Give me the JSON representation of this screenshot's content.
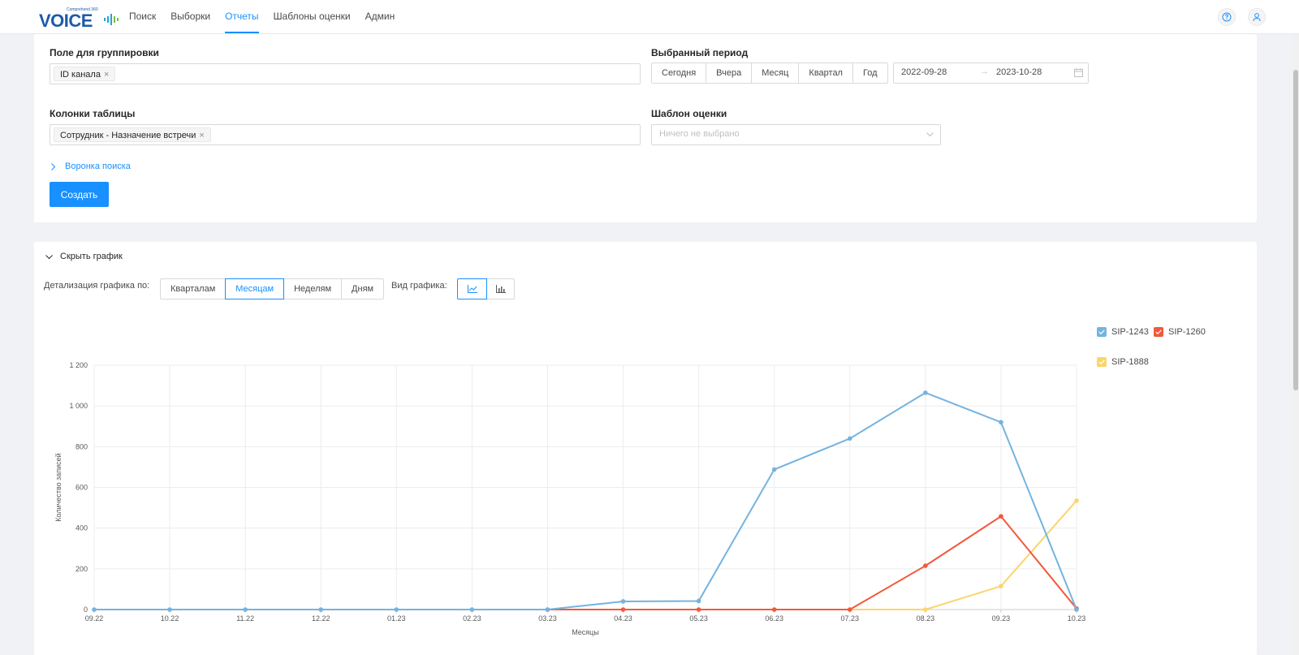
{
  "logo": {
    "small": "Comprehend 360",
    "main": "VOICE"
  },
  "nav": {
    "items": [
      {
        "label": "Поиск",
        "active": false
      },
      {
        "label": "Выборки",
        "active": false
      },
      {
        "label": "Отчеты",
        "active": true
      },
      {
        "label": "Шаблоны оценки",
        "active": false
      },
      {
        "label": "Админ",
        "active": false
      }
    ]
  },
  "icons": {
    "help": "help-circle-icon",
    "user": "user-icon"
  },
  "form": {
    "group_label": "Поле для группировки",
    "group_tag": "ID канала",
    "period_label": "Выбранный период",
    "period_buttons": [
      "Сегодня",
      "Вчера",
      "Месяц",
      "Квартал",
      "Год"
    ],
    "date_from": "2022-09-28",
    "date_arrow": "→",
    "date_to": "2023-10-28",
    "columns_label": "Колонки таблицы",
    "columns_tag": "Сотрудник - Назначение встречи",
    "template_label": "Шаблон оценки",
    "template_placeholder": "Ничего не выбрано",
    "funnel_link": "Воронка поиска",
    "create_button": "Создать",
    "tag_close": "×"
  },
  "chart_panel": {
    "toggle_label": "Скрыть график",
    "detail_label": "Детализация графика по:",
    "detail_buttons": [
      {
        "label": "Кварталам",
        "active": false
      },
      {
        "label": "Месяцам",
        "active": true
      },
      {
        "label": "Неделям",
        "active": false
      },
      {
        "label": "Дням",
        "active": false
      }
    ],
    "view_label": "Вид графика:"
  },
  "colors": {
    "accent": "#1890ff",
    "sip1243": "#74b3e0",
    "sip1260": "#f2593a",
    "sip1888": "#fbd56b"
  },
  "chart_data": {
    "type": "line",
    "categories": [
      "09.22",
      "10.22",
      "11.22",
      "12.22",
      "01.23",
      "02.23",
      "03.23",
      "04.23",
      "05.23",
      "06.23",
      "07.23",
      "08.23",
      "09.23",
      "10.23"
    ],
    "series": [
      {
        "name": "SIP-1243",
        "values": [
          0,
          0,
          0,
          0,
          0,
          0,
          0,
          40,
          42,
          688,
          840,
          1065,
          920,
          0
        ]
      },
      {
        "name": "SIP-1260",
        "values": [
          null,
          null,
          null,
          null,
          null,
          null,
          0,
          0,
          0,
          0,
          0,
          215,
          458,
          5
        ]
      },
      {
        "name": "SIP-1888",
        "values": [
          null,
          null,
          null,
          null,
          null,
          null,
          null,
          null,
          null,
          null,
          0,
          0,
          115,
          535
        ]
      }
    ],
    "title": "",
    "xlabel": "Месяцы",
    "ylabel": "Количество записей",
    "ylim": [
      0,
      1200
    ],
    "yticks": [
      "0",
      "200",
      "400",
      "600",
      "800",
      "1 000",
      "1 200"
    ],
    "grid": true,
    "legend": "top-right"
  }
}
